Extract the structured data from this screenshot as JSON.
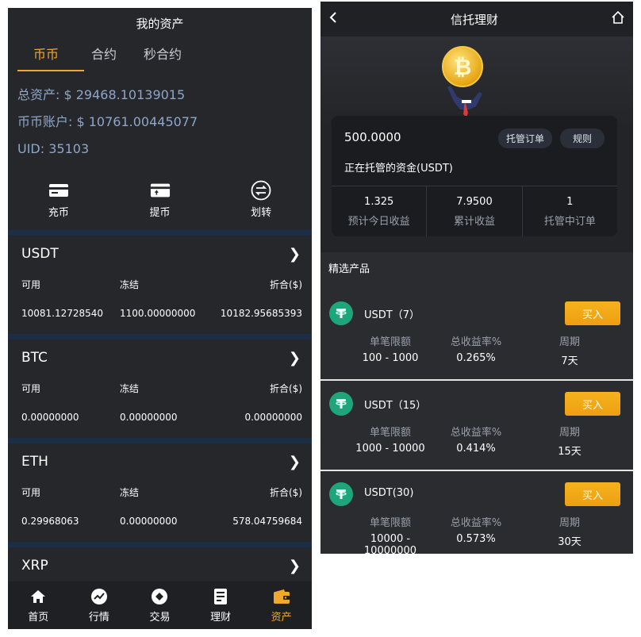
{
  "left": {
    "title": "我的资产",
    "tabs": [
      "币币",
      "合约",
      "秒合约"
    ],
    "summary": {
      "total": "总资产: $ 29468.10139015",
      "spot": "币币账户: $ 10761.00445077",
      "uid": "UID: 35103"
    },
    "actions": [
      {
        "label": "充币",
        "icon": "deposit-icon"
      },
      {
        "label": "提币",
        "icon": "withdraw-icon"
      },
      {
        "label": "划转",
        "icon": "transfer-icon"
      }
    ],
    "column_headers": {
      "available": "可用",
      "frozen": "冻结",
      "converted": "折合($)"
    },
    "assets": [
      {
        "name": "USDT",
        "available": "10081.12728540",
        "frozen": "1100.00000000",
        "converted": "10182.95685393"
      },
      {
        "name": "BTC",
        "available": "0.00000000",
        "frozen": "0.00000000",
        "converted": "0.00000000"
      },
      {
        "name": "ETH",
        "available": "0.29968063",
        "frozen": "0.00000000",
        "converted": "578.04759684"
      },
      {
        "name": "XRP",
        "available": "",
        "frozen": "",
        "converted": ""
      }
    ],
    "nav": [
      {
        "label": "首页",
        "icon": "home-icon"
      },
      {
        "label": "行情",
        "icon": "market-icon"
      },
      {
        "label": "交易",
        "icon": "trade-icon"
      },
      {
        "label": "理财",
        "icon": "finance-icon"
      },
      {
        "label": "资产",
        "icon": "wallet-icon"
      }
    ],
    "accent": "#f0a92e"
  },
  "right": {
    "title": "信托理财",
    "card": {
      "amount": "500.0000",
      "order_button": "托管订单",
      "rules_button": "规则",
      "subtitle": "正在托管的资金(USDT)",
      "stats": [
        {
          "value": "1.325",
          "label": "预计今日收益"
        },
        {
          "value": "7.9500",
          "label": "累计收益"
        },
        {
          "value": "1",
          "label": "托管中订单"
        }
      ]
    },
    "section_title": "精选产品",
    "product_labels": {
      "limit": "单笔限额",
      "rate": "总收益率%",
      "period": "周期"
    },
    "buy_label": "买入",
    "products": [
      {
        "name": "USDT（7）",
        "limit": "100 - 1000",
        "rate": "0.265%",
        "period": "7天"
      },
      {
        "name": "USDT（15）",
        "limit": "1000 - 10000",
        "rate": "0.414%",
        "period": "15天"
      },
      {
        "name": "USDT(30)",
        "limit": "10000 - 10000000",
        "rate": "0.573%",
        "period": "30天"
      }
    ]
  }
}
